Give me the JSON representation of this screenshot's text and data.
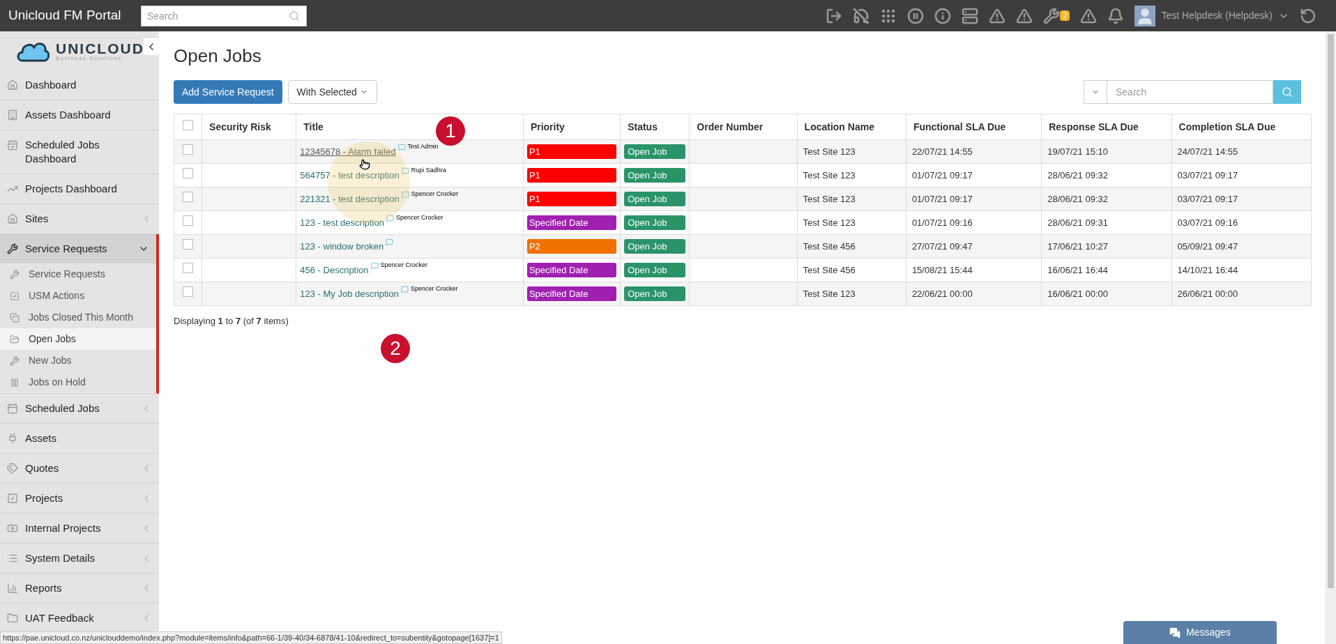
{
  "app_title": "Unicloud FM Portal",
  "top_search": {
    "placeholder": "Search"
  },
  "alert_badge": "2",
  "user": {
    "name": "Test Helpdesk (Helpdesk)"
  },
  "logo": {
    "name": "UNICLOUD",
    "tagline": "Business Solutions"
  },
  "sidebar": {
    "items": [
      {
        "label": "Dashboard",
        "expandable": false
      },
      {
        "label": "Assets Dashboard",
        "expandable": false
      },
      {
        "label": "Scheduled Jobs Dashboard",
        "expandable": false
      },
      {
        "label": "Projects Dashboard",
        "expandable": false
      },
      {
        "label": "Sites",
        "expandable": true,
        "expanded": false
      },
      {
        "label": "Service Requests",
        "expandable": true,
        "expanded": true,
        "children": [
          {
            "label": "Service Requests",
            "selected": false
          },
          {
            "label": "USM Actions",
            "selected": false
          },
          {
            "label": "Jobs Closed This Month",
            "selected": false
          },
          {
            "label": "Open Jobs",
            "selected": true
          },
          {
            "label": "New Jobs",
            "selected": false
          },
          {
            "label": "Jobs on Hold",
            "selected": false
          }
        ]
      },
      {
        "label": "Scheduled Jobs",
        "expandable": true,
        "expanded": false
      },
      {
        "label": "Assets",
        "expandable": false
      },
      {
        "label": "Quotes",
        "expandable": true,
        "expanded": false
      },
      {
        "label": "Projects",
        "expandable": true,
        "expanded": false
      },
      {
        "label": "Internal Projects",
        "expandable": true,
        "expanded": false
      },
      {
        "label": "System Details",
        "expandable": true,
        "expanded": false
      },
      {
        "label": "Reports",
        "expandable": true,
        "expanded": false
      },
      {
        "label": "UAT Feedback",
        "expandable": true,
        "expanded": false
      }
    ]
  },
  "page_title": "Open Jobs",
  "add_button": "Add Service Request",
  "with_selected": "With Selected",
  "table_search": {
    "placeholder": "Search"
  },
  "table": {
    "select_all_checked": false,
    "columns": [
      "Security Risk",
      "Title",
      "Priority",
      "Status",
      "Order Number",
      "Location Name",
      "Functional SLA Due",
      "Response SLA Due",
      "Completion SLA Due"
    ],
    "rows": [
      {
        "checked": false,
        "title": "12345678 - Alarm failed",
        "hovered": true,
        "author": "Test Admin",
        "priority": "P1",
        "color": "#ff0000",
        "status": "Open Job",
        "location": "Test Site 123",
        "functional": "22/07/21 14:55",
        "response": "19/07/21 15:10",
        "completion": "24/07/21 14:55"
      },
      {
        "checked": false,
        "title": "564757 - test description",
        "hovered": false,
        "author": "Rupi Sadhra",
        "priority": "P1",
        "color": "#ff0000",
        "status": "Open Job",
        "location": "Test Site 123",
        "functional": "01/07/21 09:17",
        "response": "28/06/21 09:32",
        "completion": "03/07/21 09:17"
      },
      {
        "checked": false,
        "title": "221321 - test description",
        "hovered": false,
        "author": "Spencer Crocker",
        "priority": "P1",
        "color": "#ff0000",
        "status": "Open Job",
        "location": "Test Site 123",
        "functional": "01/07/21 09:17",
        "response": "28/06/21 09:32",
        "completion": "03/07/21 09:17"
      },
      {
        "checked": false,
        "title": "123 - test description",
        "hovered": false,
        "author": "Spencer Crocker",
        "priority": "Specified Date",
        "color": "#a020b0",
        "status": "Open Job",
        "location": "Test Site 123",
        "functional": "01/07/21 09:16",
        "response": "28/06/21 09:31",
        "completion": "03/07/21 09:16"
      },
      {
        "checked": false,
        "title": "123 - window broken",
        "hovered": false,
        "priority": "P2",
        "color": "#f07000",
        "status": "Open Job",
        "location": "Test Site 456",
        "functional": "27/07/21 09:47",
        "response": "17/06/21 10:27",
        "completion": "05/09/21 09:47"
      },
      {
        "checked": false,
        "title": "456 - Description",
        "hovered": false,
        "author": "Spencer Crocker",
        "priority": "Specified Date",
        "color": "#a020b0",
        "status": "Open Job",
        "location": "Test Site 456",
        "functional": "15/08/21 15:44",
        "response": "16/06/21 16:44",
        "completion": "14/10/21 16:44"
      },
      {
        "checked": false,
        "title": "123 - My Job description",
        "hovered": false,
        "author": "Spencer Crocker",
        "priority": "Specified Date",
        "color": "#a020b0",
        "status": "Open Job",
        "location": "Test Site 123",
        "functional": "22/06/21 00:00",
        "response": "16/06/21 00:00",
        "completion": "26/06/21 00:00"
      }
    ]
  },
  "summary": "Displaying **1** to **7** (of **7** items)",
  "callouts": [
    "1",
    "2"
  ],
  "status_url": "https://pae.unicloud.co.nz/uniclouddemo/index.php?module=items/info&path=66-1/39-40/34-6878/41-10&redirect_to=subentity&gotopage[1637]=1",
  "messages_button": "Messages"
}
